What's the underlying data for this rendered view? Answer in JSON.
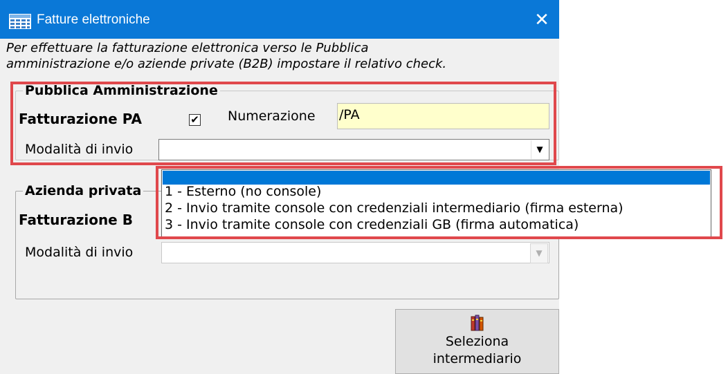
{
  "window": {
    "title": "Fatture elettroniche",
    "close_glyph": "✕"
  },
  "intro": "Per effettuare la fatturazione elettronica verso le Pubblica\namministrazione e/o aziende private (B2B) impostare il relativo check.",
  "pa_group": {
    "legend": "Pubblica Amministrazione",
    "fatturazione_label": "Fatturazione PA",
    "checkbox_checked": true,
    "checkbox_glyph": "✔",
    "numerazione_label": "Numerazione",
    "numerazione_value": "/PA",
    "modalita_label": "Modalità di invio",
    "modalita_value": "",
    "arrow_glyph": "▼"
  },
  "private_group": {
    "legend": "Azienda privata",
    "fatturazione_label": "Fatturazione B",
    "modalita_label": "Modalità di invio",
    "modalita_value": "",
    "arrow_glyph": "▼"
  },
  "dropdown": {
    "options": [
      "",
      "1 - Esterno (no console)",
      "2 - Invio tramite console con credenziali intermediario (firma esterna)",
      "3 - Invio tramite console con credenziali GB (firma automatica)"
    ],
    "selected_index": 0
  },
  "select_button": {
    "label": "Seleziona\nintermediario",
    "icon": "books-icon"
  },
  "colors": {
    "titlebar": "#0a78d7",
    "highlight": "#e0484c",
    "selection": "#0078d7",
    "field_yellow": "#ffffcc"
  }
}
